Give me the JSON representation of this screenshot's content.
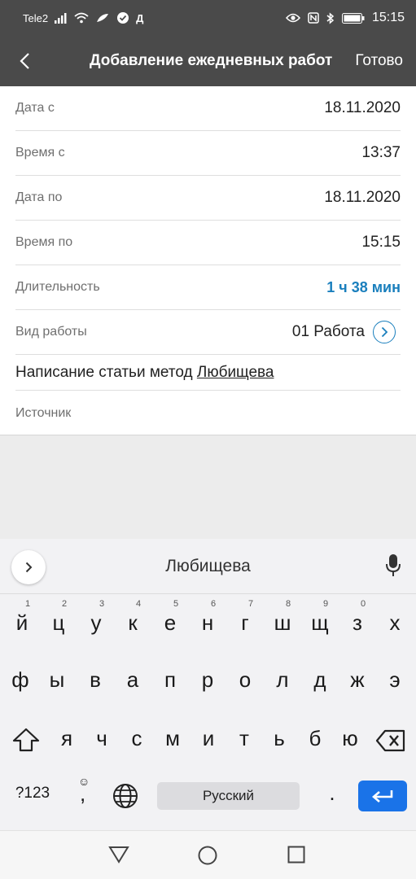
{
  "status_bar": {
    "carrier": "Tele2",
    "extra": "Д",
    "time": "15:15"
  },
  "header": {
    "title": "Добавление ежедневных работ",
    "done_label": "Готово"
  },
  "form": {
    "date_from": {
      "label": "Дата с",
      "value": "18.11.2020"
    },
    "time_from": {
      "label": "Время с",
      "value": "13:37"
    },
    "date_to": {
      "label": "Дата по",
      "value": "18.11.2020"
    },
    "time_to": {
      "label": "Время по",
      "value": "15:15"
    },
    "duration": {
      "label": "Длительность",
      "value": "1 ч 38 мин"
    },
    "work_type": {
      "label": "Вид работы",
      "value": "01 Работа"
    },
    "description": {
      "prefix": "Написание статьи метод ",
      "underlined": "Любищева"
    },
    "source": {
      "label": "Источник"
    }
  },
  "keyboard": {
    "suggestion": "Любищева",
    "row1": [
      "й",
      "ц",
      "у",
      "к",
      "е",
      "н",
      "г",
      "ш",
      "щ",
      "з",
      "х"
    ],
    "row1_hints": [
      "1",
      "2",
      "3",
      "4",
      "5",
      "6",
      "7",
      "8",
      "9",
      "0"
    ],
    "row2": [
      "ф",
      "ы",
      "в",
      "а",
      "п",
      "р",
      "о",
      "л",
      "д",
      "ж",
      "э"
    ],
    "row3": [
      "я",
      "ч",
      "с",
      "м",
      "и",
      "т",
      "ь",
      "б",
      "ю"
    ],
    "symbols_label": "?123",
    "comma": ",",
    "space_label": "Русский",
    "period": "."
  },
  "colors": {
    "accent": "#1a7fbd",
    "header_bg": "#4a4a4a",
    "enter_key": "#1a73e8"
  }
}
